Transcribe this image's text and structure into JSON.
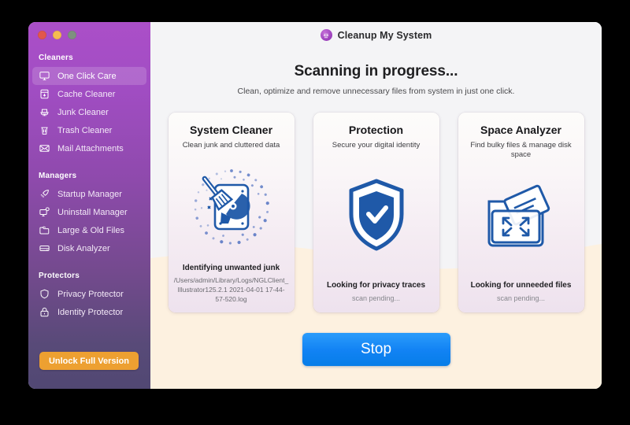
{
  "window": {
    "traffic_lights": [
      {
        "name": "close",
        "color": "#e2574c"
      },
      {
        "name": "minimize",
        "color": "#f5bc4f"
      },
      {
        "name": "zoom",
        "color": "#7e9180"
      }
    ]
  },
  "sidebar": {
    "sections": [
      {
        "heading": "Cleaners",
        "items": [
          {
            "label": "One Click Care",
            "icon": "monitor-icon",
            "active": true
          },
          {
            "label": "Cache Cleaner",
            "icon": "cache-box-icon",
            "active": false
          },
          {
            "label": "Junk Cleaner",
            "icon": "broom-icon",
            "active": false
          },
          {
            "label": "Trash Cleaner",
            "icon": "trash-icon",
            "active": false
          },
          {
            "label": "Mail Attachments",
            "icon": "envelope-icon",
            "active": false
          }
        ]
      },
      {
        "heading": "Managers",
        "items": [
          {
            "label": "Startup Manager",
            "icon": "rocket-icon",
            "active": false
          },
          {
            "label": "Uninstall Manager",
            "icon": "monitor-gear-icon",
            "active": false
          },
          {
            "label": "Large & Old Files",
            "icon": "folder-icon",
            "active": false
          },
          {
            "label": "Disk Analyzer",
            "icon": "disk-icon",
            "active": false
          }
        ]
      },
      {
        "heading": "Protectors",
        "items": [
          {
            "label": "Privacy Protector",
            "icon": "shield-icon",
            "active": false
          },
          {
            "label": "Identity Protector",
            "icon": "lock-icon",
            "active": false
          }
        ]
      }
    ],
    "unlock_label": "Unlock Full Version",
    "unlock_color": "#eda031"
  },
  "header": {
    "logo_icon": "cleanup-app-icon",
    "app_title": "Cleanup My System"
  },
  "main": {
    "page_title": "Scanning in progress...",
    "page_subtitle": "Clean, optimize and remove unnecessary files from system in just one click.",
    "cards": [
      {
        "title": "System Cleaner",
        "subtitle": "Clean junk and cluttered data",
        "icon": "disk-broom-scanning-icon",
        "status": "Identifying unwanted junk",
        "detail": "/Users/admin/Library/Logs/NGLClient_Illustrator125.2.1 2021-04-01 17-44-57-520.log",
        "pending": false
      },
      {
        "title": "Protection",
        "subtitle": "Secure your digital identity",
        "icon": "shield-check-icon",
        "status": "Looking for privacy traces",
        "detail": "scan pending...",
        "pending": true
      },
      {
        "title": "Space Analyzer",
        "subtitle": "Find bulky files & manage disk space",
        "icon": "folder-expand-icon",
        "status": "Looking for unneeded files",
        "detail": "scan pending...",
        "pending": true
      }
    ],
    "stop_label": "Stop",
    "stop_color": "#1283f4"
  }
}
